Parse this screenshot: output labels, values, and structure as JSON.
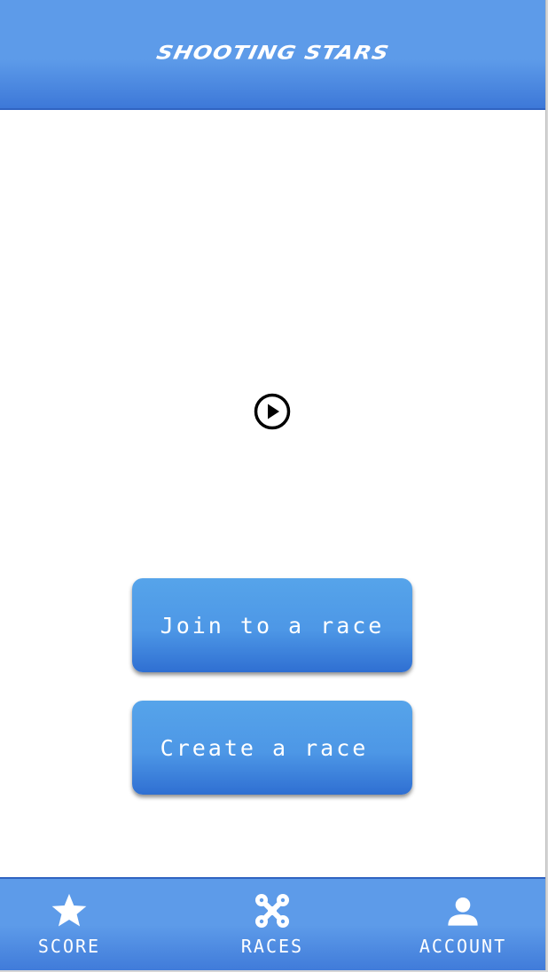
{
  "header": {
    "title": "SHOOTING STARS"
  },
  "video": {
    "play_icon": "play-circle-icon"
  },
  "actions": {
    "join_label": "Join to a race",
    "create_label": "Create a race"
  },
  "nav": {
    "items": [
      {
        "label": "SCORE",
        "icon": "star-icon"
      },
      {
        "label": "RACES",
        "icon": "drone-icon"
      },
      {
        "label": "ACCOUNT",
        "icon": "person-icon"
      }
    ]
  },
  "colors": {
    "brand_blue": "#5d9be9",
    "button_blue": "#4d97e6",
    "text_on_brand": "#ffffff"
  }
}
